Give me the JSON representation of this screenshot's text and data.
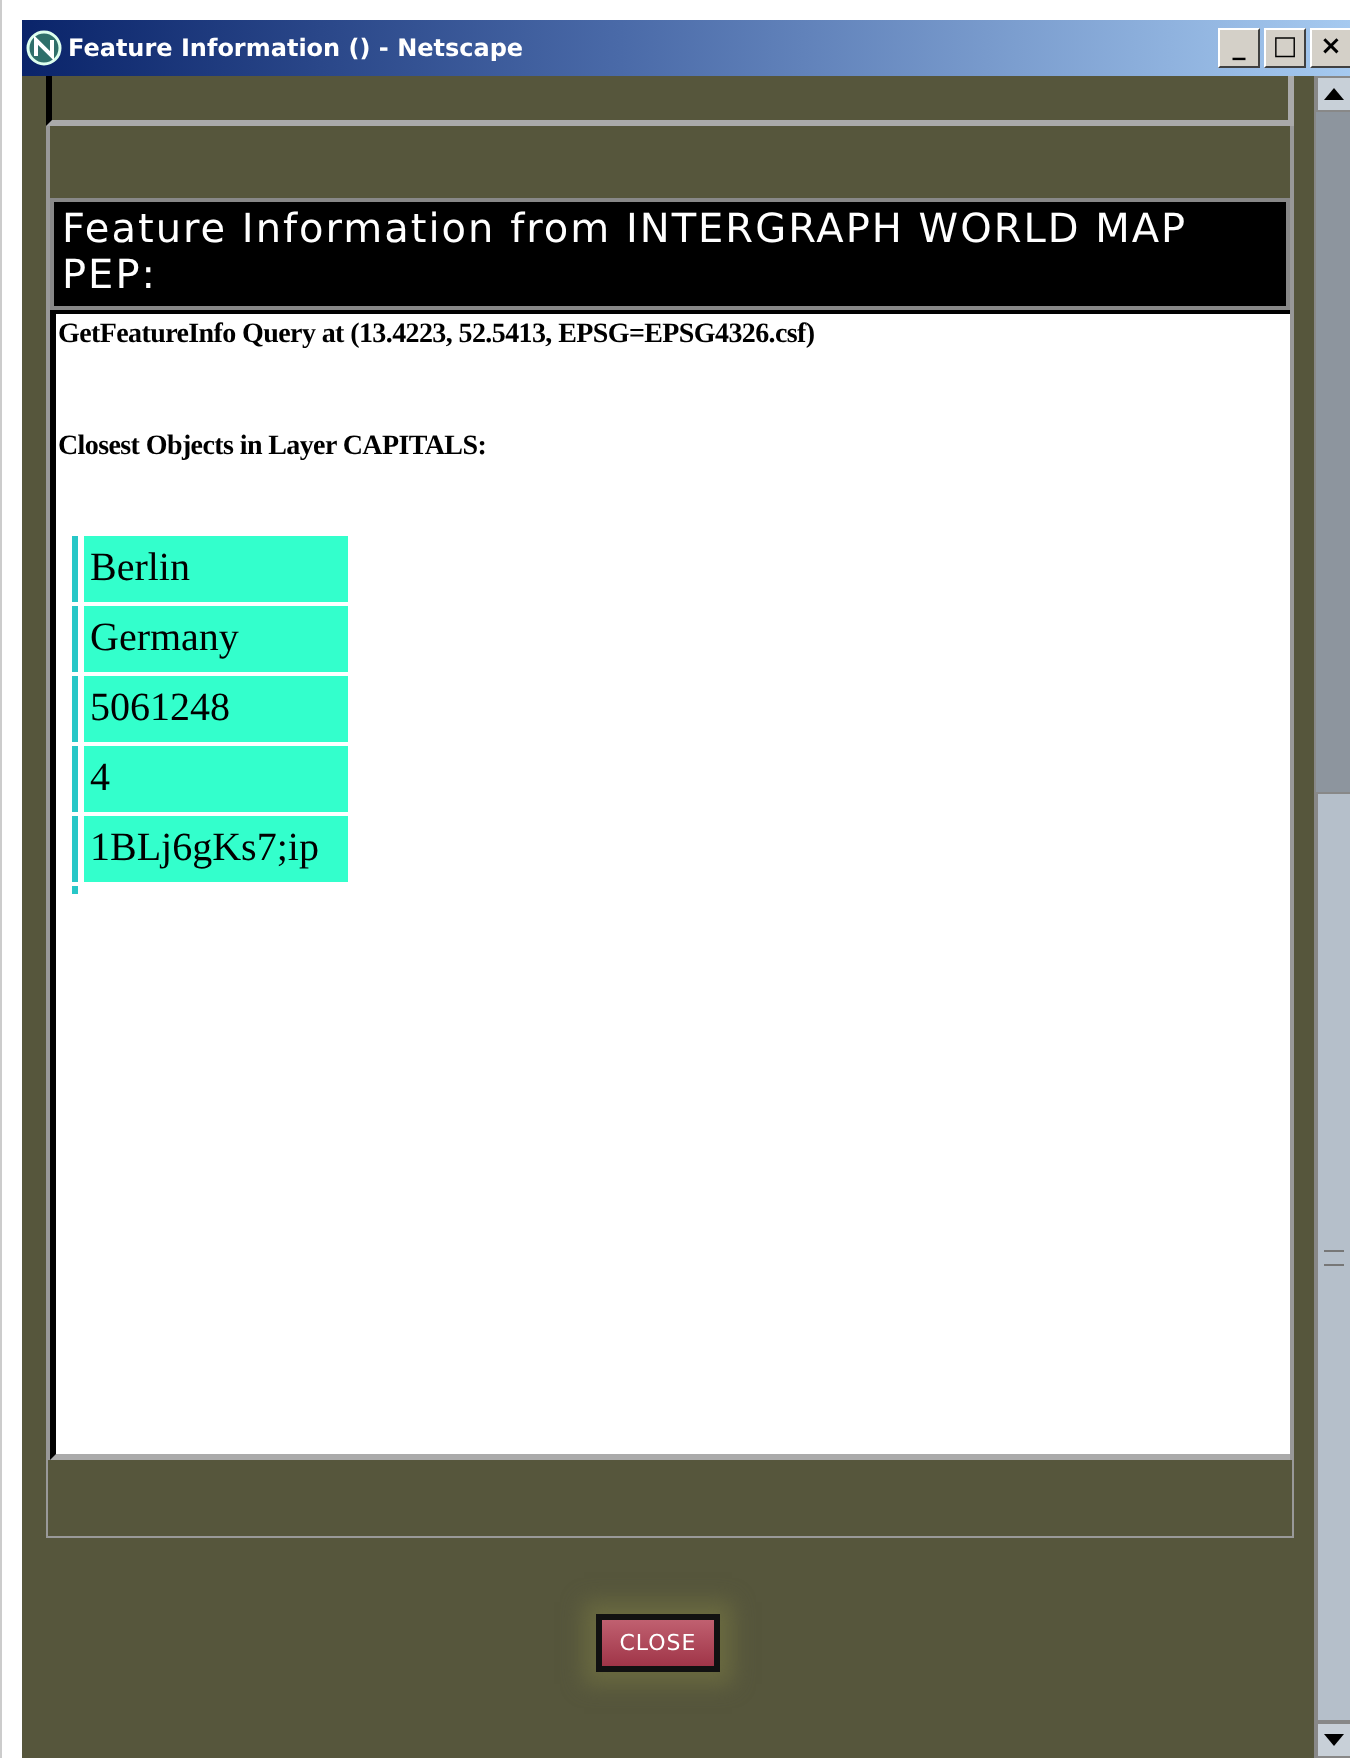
{
  "window": {
    "title": "Feature Information () - Netscape",
    "controls": [
      "_",
      "□",
      "×"
    ]
  },
  "heading": "Feature Information from INTERGRAPH WORLD MAP PEP:",
  "query": "GetFeatureInfo Query at (13.4223, 52.5413, EPSG=EPSG4326.csf)",
  "layer_title": "Closest Objects in Layer CAPITALS:",
  "table": {
    "rows": [
      "Berlin",
      "Germany",
      "5061248",
      "4",
      "1BLj6gKs7;ip"
    ]
  },
  "buttons": [
    "CLOSE"
  ]
}
